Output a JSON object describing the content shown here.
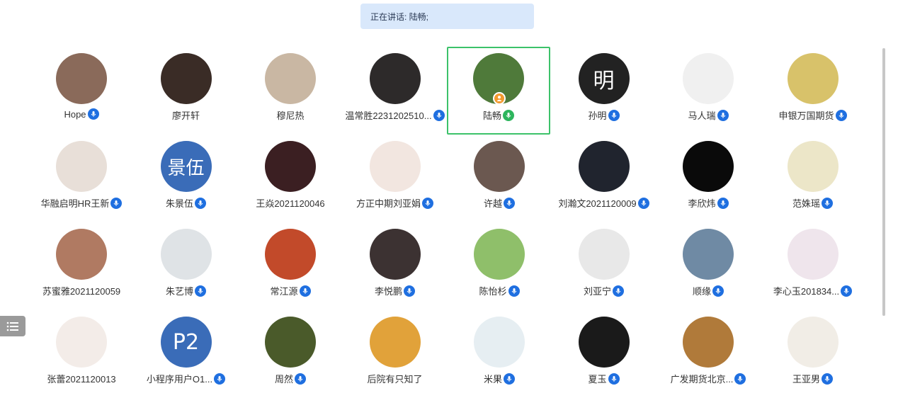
{
  "banner": {
    "text": "正在讲话: 陆畅;"
  },
  "participants": [
    {
      "name": "Hope",
      "mic": "blue",
      "avatar_color": "#8a6a5a"
    },
    {
      "name": "廖开轩",
      "mic": "none",
      "avatar_color": "#3a2c26"
    },
    {
      "name": "穆尼热",
      "mic": "none",
      "avatar_color": "#c9b7a3"
    },
    {
      "name": "温常胜2231202510...",
      "mic": "blue",
      "avatar_color": "#2d2a2a"
    },
    {
      "name": "陆畅",
      "mic": "green",
      "avatar_color": "#4f7a3a",
      "active": true,
      "host": true
    },
    {
      "name": "孙明",
      "mic": "blue",
      "avatar_color": "#222222",
      "avatar_text": "明",
      "avatar_text_color": "#ffffff"
    },
    {
      "name": "马人瑞",
      "mic": "blue",
      "avatar_color": "#f0f0f0"
    },
    {
      "name": "申银万国期货",
      "mic": "blue",
      "avatar_color": "#d8c26a"
    },
    {
      "name": "华融启明HR王新",
      "mic": "blue",
      "avatar_color": "#e8dfd8"
    },
    {
      "name": "朱景伍",
      "mic": "blue",
      "avatar_color": "#3a6cb8",
      "avatar_text": "景伍",
      "avatar_text_color": "#ffffff"
    },
    {
      "name": "王焱2021120046",
      "mic": "none",
      "avatar_color": "#3b1f22"
    },
    {
      "name": "方正中期刘亚娟",
      "mic": "blue",
      "avatar_color": "#f2e6e0"
    },
    {
      "name": "许越",
      "mic": "blue",
      "avatar_color": "#6b5850"
    },
    {
      "name": "刘瀚文2021120009",
      "mic": "blue",
      "avatar_color": "#20242e"
    },
    {
      "name": "李欣炜",
      "mic": "blue",
      "avatar_color": "#0a0a0a"
    },
    {
      "name": "范姝瑶",
      "mic": "blue",
      "avatar_color": "#ece6c8"
    },
    {
      "name": "苏蜜雅2021120059",
      "mic": "none",
      "avatar_color": "#b07a62"
    },
    {
      "name": "朱艺博",
      "mic": "blue",
      "avatar_color": "#dfe3e6"
    },
    {
      "name": "常江源",
      "mic": "blue",
      "avatar_color": "#c24a2a"
    },
    {
      "name": "李悦鹏",
      "mic": "blue",
      "avatar_color": "#3c3232"
    },
    {
      "name": "陈怡杉",
      "mic": "blue",
      "avatar_color": "#8fbf6a"
    },
    {
      "name": "刘亚宁",
      "mic": "blue",
      "avatar_color": "#e8e8e8"
    },
    {
      "name": "顺缘",
      "mic": "blue",
      "avatar_color": "#6f8aa4"
    },
    {
      "name": "李心玉201834...",
      "mic": "blue",
      "avatar_color": "#efe5ec"
    },
    {
      "name": "张蕾2021120013",
      "mic": "none",
      "avatar_color": "#f3ece8"
    },
    {
      "name": "小程序用户O1...",
      "mic": "blue",
      "avatar_color": "#3a6cb8",
      "avatar_text": "P2",
      "avatar_text_color": "#ffffff"
    },
    {
      "name": "周然",
      "mic": "blue",
      "avatar_color": "#4a5a2a"
    },
    {
      "name": "后院有只知了",
      "mic": "none",
      "avatar_color": "#e1a23a"
    },
    {
      "name": "米果",
      "mic": "blue",
      "avatar_color": "#e6eef2"
    },
    {
      "name": "夏玉",
      "mic": "blue",
      "avatar_color": "#1a1a1a"
    },
    {
      "name": "广发期货北京...",
      "mic": "blue",
      "avatar_color": "#b07a3a"
    },
    {
      "name": "王亚男",
      "mic": "blue",
      "avatar_color": "#f1ede6"
    }
  ],
  "icons": {
    "mic": "microphone-icon",
    "menu": "list-menu-icon",
    "host": "person-icon"
  }
}
